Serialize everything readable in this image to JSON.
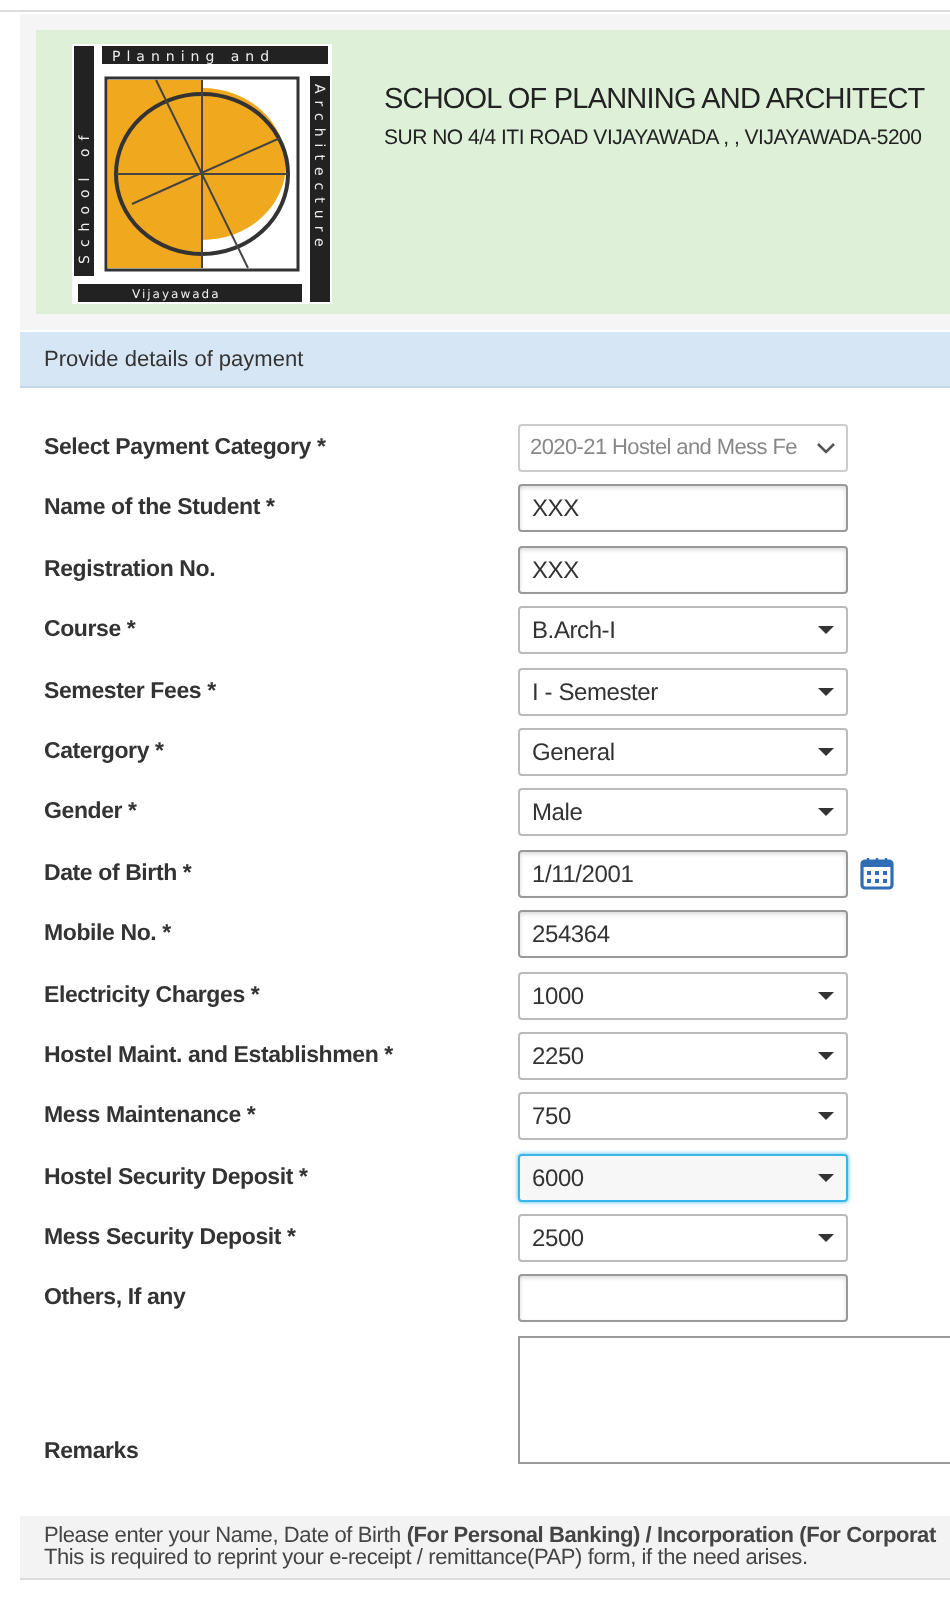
{
  "header": {
    "logo_texts": {
      "top": "Planning and",
      "left": "School of",
      "right": "Architecture",
      "bottom": "Vijayawada"
    },
    "title": "SCHOOL OF PLANNING AND ARCHITECT",
    "address": "SUR NO 4/4 ITI ROAD VIJAYAWADA , , VIJAYAWADA-5200"
  },
  "section_title": "Provide details of payment",
  "fields": [
    {
      "label": "Select Payment Category *",
      "kind": "native_select",
      "value": "2020-21 Hostel and Mess Fe",
      "focused": false
    },
    {
      "label": "Name of the Student *",
      "kind": "input",
      "value": "XXX",
      "focused": false
    },
    {
      "label": "Registration No.",
      "kind": "input",
      "value": "XXX",
      "focused": false
    },
    {
      "label": "Course *",
      "kind": "select",
      "value": "B.Arch-I",
      "focused": false
    },
    {
      "label": "Semester Fees *",
      "kind": "select",
      "value": "I - Semester",
      "focused": false
    },
    {
      "label": "Catergory *",
      "kind": "select",
      "value": "General",
      "focused": false
    },
    {
      "label": "Gender *",
      "kind": "select",
      "value": "Male",
      "focused": false
    },
    {
      "label": "Date of Birth *",
      "kind": "date",
      "value": "1/11/2001",
      "focused": false
    },
    {
      "label": "Mobile No. *",
      "kind": "input",
      "value": "254364",
      "focused": false
    },
    {
      "label": "Electricity Charges *",
      "kind": "select",
      "value": "1000",
      "focused": false
    },
    {
      "label": "Hostel Maint. and Establishmen *",
      "kind": "select",
      "value": "2250",
      "focused": false
    },
    {
      "label": "Mess Maintenance *",
      "kind": "select",
      "value": "750",
      "focused": false
    },
    {
      "label": "Hostel Security Deposit *",
      "kind": "select",
      "value": "6000",
      "focused": true
    },
    {
      "label": "Mess Security Deposit *",
      "kind": "select",
      "value": "2500",
      "focused": false
    },
    {
      "label": "Others, If any",
      "kind": "input",
      "focused": false
    },
    {
      "label": "Remarks",
      "kind": "textarea",
      "focused": false
    }
  ],
  "footer_lines": [
    "Please enter your Name, Date of Birth **(For Personal Banking) / Incorporation (For Corporat**",
    "This is required to reprint your e-receipt / remittance(PAP) form, if the need arises."
  ]
}
